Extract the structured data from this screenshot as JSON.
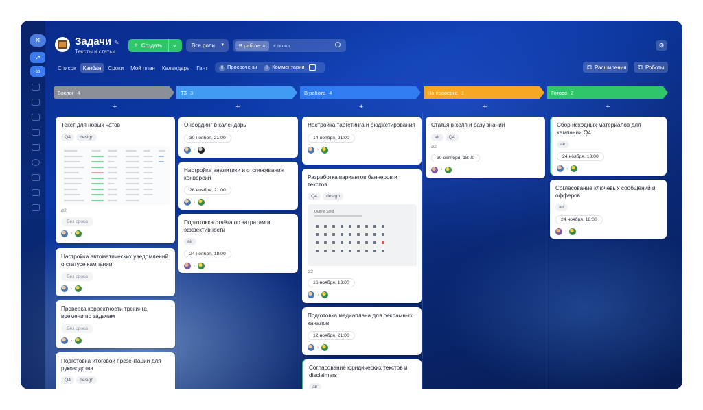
{
  "header": {
    "title": "Задачи",
    "subtitle": "Тексты и статьи",
    "create_label": "Создать",
    "roles_label": "Все роли",
    "search_chip": "В работе",
    "search_placeholder": "+ поиск"
  },
  "views": [
    "Список",
    "Канбан",
    "Сроки",
    "Мой план",
    "Календарь",
    "Гант"
  ],
  "active_view": "Канбан",
  "filters": {
    "overdue_label": "Просрочены",
    "overdue_count": "0",
    "comments_label": "Комментарии",
    "comments_count": "0"
  },
  "right_buttons": {
    "extensions": "Расширения",
    "robots": "Роботы"
  },
  "columns": [
    {
      "name": "Бэклог",
      "count": "4",
      "color": "#8a8f98"
    },
    {
      "name": "ТЗ",
      "count": "3",
      "color": "#3f9cf2"
    },
    {
      "name": "В работе",
      "count": "4",
      "color": "#2f7df0"
    },
    {
      "name": "На проверке",
      "count": "1",
      "color": "#f5a623"
    },
    {
      "name": "Готово",
      "count": "2",
      "color": "#2fc56a"
    }
  ],
  "cards": {
    "c1": {
      "title": "Текст для новых чатов",
      "tags": [
        "Q4",
        "design"
      ],
      "attach": "2",
      "date": "Без срока"
    },
    "c2": {
      "title": "Настройка автоматических уведомлений о статусе кампании",
      "date": "Без срока"
    },
    "c3": {
      "title": "Проверка корректности трекинга времени по задачам",
      "date": "Без срока"
    },
    "c4": {
      "title": "Подготовка итоговой презентации для руководства",
      "tags": [
        "Q4",
        "design"
      ]
    },
    "c5": {
      "title": "Онбординг в календарь",
      "date": "30 ноября, 21:00"
    },
    "c6": {
      "title": "Настройка аналитики и отслеживания конверсий",
      "date": "26 ноября, 21:00"
    },
    "c7": {
      "title": "Подготовка отчёта по затратам и эффективности",
      "tags": [
        "air"
      ],
      "date": "24 ноября, 18:00"
    },
    "c8": {
      "title": "Настройка таргетинга и бюджетирования",
      "date": "14 ноября, 21:00"
    },
    "c9": {
      "title": "Разработка вариантов баннеров и текстов",
      "tags": [
        "Q4",
        "design"
      ],
      "attach": "2",
      "date": "16 ноября, 13:00",
      "thumb_title": "Outline Solid"
    },
    "c10": {
      "title": "Подготовка медиаплана для рекламных каналов",
      "date": "12 ноября, 21:00"
    },
    "c11": {
      "title": "Согласование юридических текстов и disclaimers",
      "tags": [
        "air"
      ]
    },
    "c12": {
      "title": "Статья в хелп и базу знаний",
      "tags": [
        "air",
        "Q4"
      ],
      "attach": "2",
      "date": "30 октября, 18:00"
    },
    "c13": {
      "title": "Сбор исходных материалов для кампании Q4",
      "tags": [
        "air"
      ],
      "date": "24 ноября, 18:00"
    },
    "c14": {
      "title": "Согласование ключевых сообщений и офферов",
      "tags": [
        "air"
      ],
      "date": "24 ноября, 18:00"
    }
  }
}
